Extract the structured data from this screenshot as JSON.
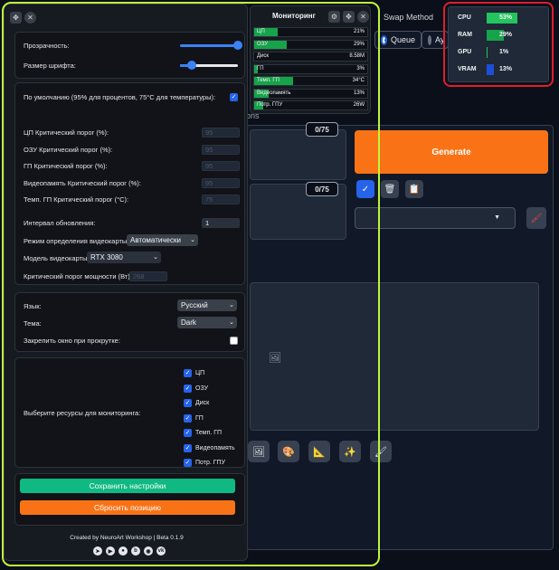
{
  "background": {
    "swap_title": "Swap Method",
    "options": [
      "Queue",
      "Ay"
    ],
    "section_tab": "ons",
    "counters": [
      "0/75",
      "0/75"
    ],
    "generate_label": "Generate"
  },
  "settings": {
    "top_icons": [
      "move-icon",
      "close-icon"
    ],
    "transparency_label": "Прозрачность:",
    "transparency_value": 1.0,
    "font_size_label": "Размер шрифта:",
    "font_size_value": 0.2,
    "defaults_label": "По умолчанию (95% для процентов, 75°C для температуры):",
    "defaults_checked": true,
    "thresholds": [
      {
        "label": "ЦП Критический порог (%):",
        "value": "95"
      },
      {
        "label": "ОЗУ Критический порог (%):",
        "value": "95"
      },
      {
        "label": "ГП Критический порог (%):",
        "value": "95"
      },
      {
        "label": "Видеопамять Критический порог (%):",
        "value": "95"
      },
      {
        "label": "Темп. ГП Критический порог (°C):",
        "value": "75"
      }
    ],
    "interval_label": "Интервал обновления:",
    "interval_value": "1",
    "gpu_mode_label": "Режим определения видеокарты:",
    "gpu_mode_value": "Автоматически",
    "gpu_model_label": "Модель видеокарты:",
    "gpu_model_value": "RTX 3080",
    "power_label": "Критический порог мощности (Вт):",
    "power_value": "268",
    "language_label": "Язык:",
    "language_value": "Русский",
    "theme_label": "Тема:",
    "theme_value": "Dark",
    "pin_label": "Закрепить окно при прокрутке:",
    "pin_checked": false,
    "resources_label": "Выберите ресурсы для мониторинга:",
    "resources": [
      "ЦП",
      "ОЗУ",
      "Диск",
      "ГП",
      "Темп. ГП",
      "Видеопамять",
      "Потр. ГПУ"
    ],
    "save_label": "Сохранить настройки",
    "reset_label": "Сбросить позицию",
    "credit": "Created by NeuroArt Workshop | Beta 0.1.9",
    "social_icons": [
      "telegram-icon",
      "youtube-icon",
      "github-icon",
      "boosty-icon",
      "discord-icon",
      "vk-icon"
    ]
  },
  "monitor": {
    "title": "Мониторинг",
    "rows": [
      {
        "label": "ЦП",
        "value": "21%",
        "fill": 0.21
      },
      {
        "label": "ОЗУ",
        "value": "29%",
        "fill": 0.29
      },
      {
        "label": "Диск",
        "value": "8.58M",
        "fill": 0.0
      },
      {
        "label": "ГП",
        "value": "3%",
        "fill": 0.03
      },
      {
        "label": "Темп. ГП",
        "value": "34°C",
        "fill": 0.34
      },
      {
        "label": "Видеопамять",
        "value": "13%",
        "fill": 0.13
      },
      {
        "label": "Потр. ГПУ",
        "value": "26W",
        "fill": 0.08
      }
    ]
  },
  "mini_stats": [
    {
      "label": "CPU",
      "value": "53%",
      "fill": 0.53,
      "color": "#22c55e"
    },
    {
      "label": "RAM",
      "value": "29%",
      "fill": 0.29,
      "color": "#16a34a"
    },
    {
      "label": "GPU",
      "value": "1%",
      "fill": 0.01,
      "color": "#22c55e"
    },
    {
      "label": "VRAM",
      "value": "13%",
      "fill": 0.13,
      "color": "#1d4ed8"
    }
  ],
  "colors": {
    "highlight_yellow": "#bef53a",
    "highlight_red": "#e11d2e",
    "accent": "#f97316",
    "save": "#10b981"
  }
}
